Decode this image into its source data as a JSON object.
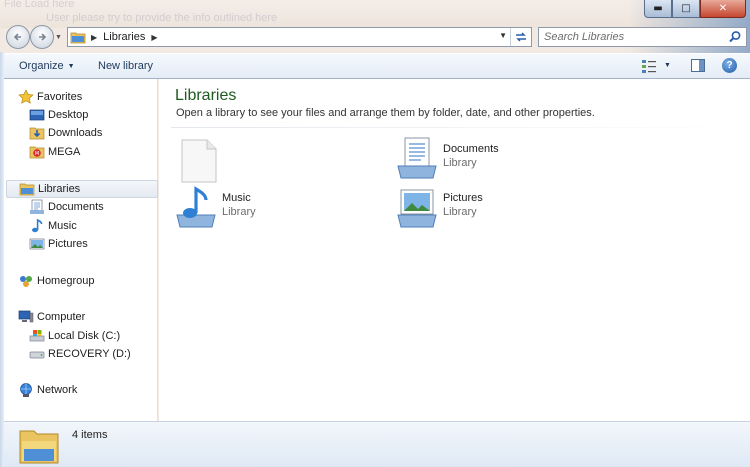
{
  "background": {
    "ghost_line1": "File   Load here",
    "ghost_line2": "User please try to provide the info outlined here"
  },
  "caption": {
    "minimize": "▬",
    "maximize": "□",
    "close": "✕"
  },
  "address_bar": {
    "location": "Libraries"
  },
  "search": {
    "placeholder": "Search Libraries"
  },
  "toolbar": {
    "organize_label": "Organize",
    "new_library_label": "New library",
    "help_label": "?"
  },
  "nav_pane": {
    "favorites": {
      "label": "Favorites",
      "items": [
        "Desktop",
        "Downloads",
        "MEGA"
      ]
    },
    "libraries": {
      "label": "Libraries",
      "items": [
        "Documents",
        "Music",
        "Pictures"
      ]
    },
    "homegroup": {
      "label": "Homegroup"
    },
    "computer": {
      "label": "Computer",
      "items": [
        "Local Disk (C:)",
        "RECOVERY (D:)"
      ]
    },
    "network": {
      "label": "Network"
    }
  },
  "content": {
    "title": "Libraries",
    "subtitle": "Open a library to see your files and arrange them by folder, date, and other properties.",
    "tiles": [
      {
        "name": "",
        "type": "",
        "icon": "blank-file-icon"
      },
      {
        "name": "Documents",
        "type": "Library",
        "icon": "documents-library-icon"
      },
      {
        "name": "Music",
        "type": "Library",
        "icon": "music-library-icon"
      },
      {
        "name": "Pictures",
        "type": "Library",
        "icon": "pictures-library-icon"
      }
    ]
  },
  "status_bar": {
    "item_count": "4 items"
  },
  "colors": {
    "title_green": "#1e5b1e",
    "toolbar_text": "#1e395b",
    "close_red": "#c5462f",
    "accent_blue": "#2b5fa8"
  }
}
